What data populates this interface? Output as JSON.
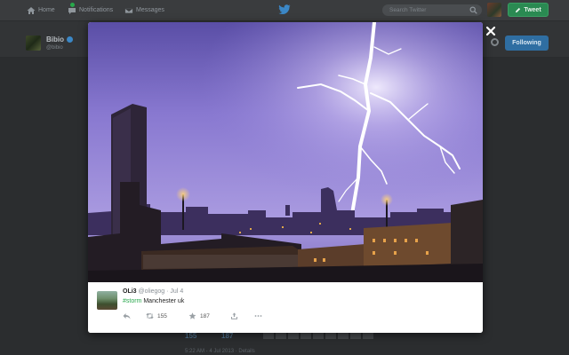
{
  "nav": {
    "home": "Home",
    "notifications": "Notifications",
    "messages": "Messages",
    "search_placeholder": "Search Twitter",
    "tweet_button": "Tweet"
  },
  "profile": {
    "name": "Bibio",
    "handle": "@bibio",
    "follow_state": "Following"
  },
  "background": {
    "retweets_count": "155",
    "favorites_count": "187",
    "timestamp": "5:22 AM - 4 Jul 2013 · Details"
  },
  "tweet": {
    "display_name": "OLi3",
    "handle": "@oliegog",
    "date": "· Jul 4",
    "hashtag": "#storm",
    "text": " Manchester uk",
    "retweets": "155",
    "favorites": "187"
  },
  "colors": {
    "accent_green": "#2aa84e",
    "follow_blue": "#2f6ea2",
    "sky": "#8d7fd4",
    "lightning": "#ffffff"
  },
  "icons": [
    "home-icon",
    "notifications-icon",
    "messages-icon",
    "bird-logo-icon",
    "search-icon",
    "close-icon",
    "reply-icon",
    "retweet-icon",
    "favorite-icon",
    "share-icon",
    "more-icon"
  ]
}
